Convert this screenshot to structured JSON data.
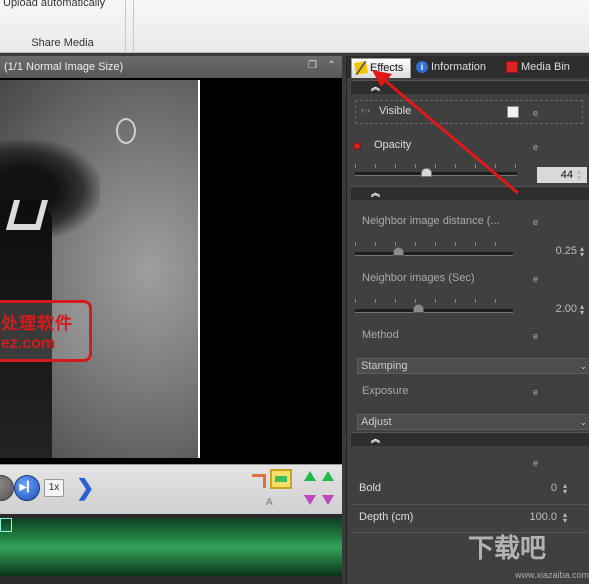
{
  "ribbon": {
    "upload_label": "Upload automatically",
    "group_title": "Share Media"
  },
  "preview": {
    "header": "(1/1  Normal Image Size)",
    "restore_icon": "window-restore-icon",
    "collapse_icon": "double-chevron-up-icon",
    "stamp_line1": "处理软件",
    "stamp_line2": "ez.com"
  },
  "playback": {
    "speed": "1x",
    "tool_label": "A"
  },
  "tabs": [
    {
      "label": "Effects",
      "icon": "magic-wand-icon"
    },
    {
      "label": "Information",
      "icon": "info-icon"
    },
    {
      "label": "Media Bin",
      "icon": "media-bin-icon"
    }
  ],
  "effects": {
    "visible_label": "Visible",
    "opacity_label": "Opacity",
    "opacity_value": "44",
    "opacity_fraction": 0.44,
    "neighbor_distance_label": "Neighbor image distance (...",
    "neighbor_distance_value": "0.25",
    "neighbor_images_label": "Neighbor images (Sec)",
    "neighbor_images_value": "2.00",
    "method_label": "Method",
    "method_value": "Stamping",
    "exposure_label": "Exposure",
    "exposure_value": "Adjust",
    "bold_label": "Bold",
    "bold_value": "0",
    "depth_label": "Depth (cm)",
    "depth_value": "100.0"
  },
  "watermark": {
    "text": "下载吧",
    "sub": "www.xiazaiba.com"
  },
  "colors": {
    "accent_red": "#d21b1b",
    "panel_bg": "#404040",
    "timeline_green": "#35a45c"
  }
}
